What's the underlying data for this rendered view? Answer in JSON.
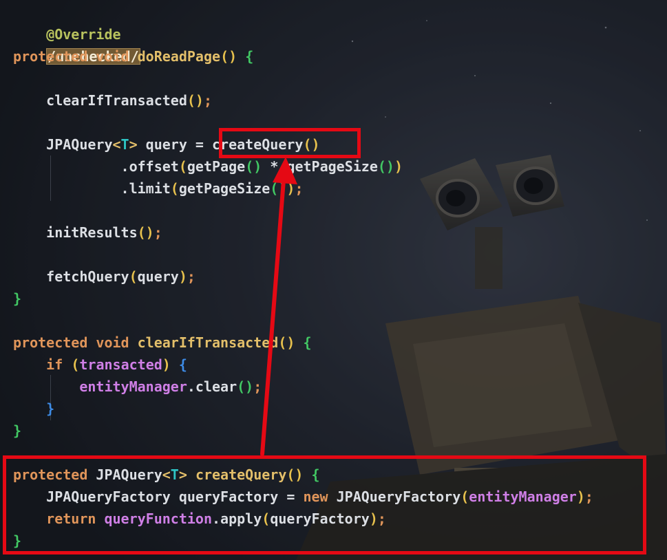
{
  "code": {
    "line1": {
      "annotation": "@Override"
    },
    "line2": {
      "comment": "/unchecked/"
    },
    "line3": {
      "kw1": "protected",
      "kw2": "void",
      "fn": "doReadPage",
      "paren": "()",
      "brace": "{"
    },
    "line4": {
      "call": "clearIfTransacted",
      "paren": "()",
      "semi": ";"
    },
    "line5": {
      "type": "JPAQuery",
      "lt": "<",
      "tparam": "T",
      "gt": ">",
      "var": " query = ",
      "call": "createQuery",
      "paren": "()"
    },
    "line6": {
      "method": ".offset",
      "open": "(",
      "call1": "getPage",
      "paren1": "()",
      "op": " * ",
      "call2": "getPageSize",
      "paren2": "()",
      "close": ")"
    },
    "line7": {
      "method": ".limit",
      "open": "(",
      "call": "getPageSize",
      "paren": "()",
      "close": ")",
      "semi": ";"
    },
    "line8": {
      "call": "initResults",
      "paren": "()",
      "semi": ";"
    },
    "line9": {
      "call": "fetchQuery",
      "open": "(",
      "arg": "query",
      "close": ")",
      "semi": ";"
    },
    "line10": {
      "brace": "}"
    },
    "line11": {
      "kw1": "protected",
      "kw2": "void",
      "fn": "clearIfTransacted",
      "paren": "()",
      "brace": "{"
    },
    "line12": {
      "kw": "if",
      "open": "(",
      "field": "transacted",
      "close": ")",
      "brace": "{"
    },
    "line13": {
      "field": "entityManager",
      "method": ".clear",
      "paren": "()",
      "semi": ";"
    },
    "line14": {
      "brace": "}"
    },
    "line15": {
      "brace": "}"
    },
    "line16": {
      "kw": "protected",
      "type": "JPAQuery",
      "lt": "<",
      "tparam": "T",
      "gt": ">",
      "fn": "createQuery",
      "paren": "()",
      "brace": "{"
    },
    "line17": {
      "type": "JPAQueryFactory",
      "var": " queryFactory = ",
      "kw": "new",
      "ctor": " JPAQueryFactory",
      "open": "(",
      "field": "entityManager",
      "close": ")",
      "semi": ";"
    },
    "line18": {
      "kw": "return",
      "field": "queryFunction",
      "method": ".apply",
      "open": "(",
      "arg": "queryFactory",
      "close": ")",
      "semi": ";"
    },
    "line19": {
      "brace": "}"
    }
  },
  "highlights": [
    {
      "label": "createQuery call"
    },
    {
      "label": "createQuery method definition"
    }
  ],
  "colors": {
    "keyword": "#e0955a",
    "function": "#e3bf6a",
    "type_param": "#2ec4c4",
    "field": "#cf7fe6",
    "highlight_box": "#e50914"
  }
}
